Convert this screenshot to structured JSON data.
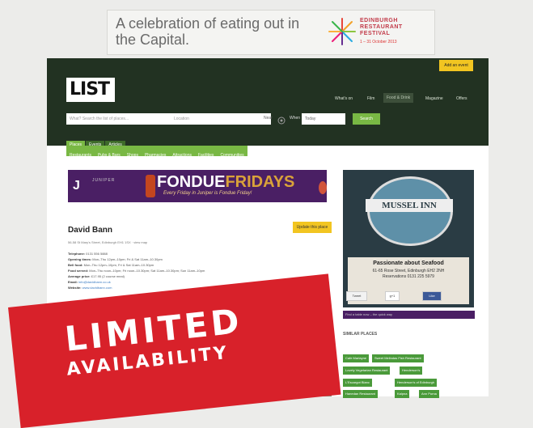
{
  "ad_banner": {
    "text": "A celebration of eating out in the Capital.",
    "festival_name": "EDINBURGH RESTAURANT FESTIVAL",
    "festival_dates": "1 – 31 October 2013"
  },
  "header": {
    "add_event_label": "Add an event",
    "logo": "LIST",
    "nav": [
      "What's on",
      "Film",
      "Food & Drink",
      "Magazine",
      "Offers"
    ]
  },
  "search": {
    "what_placeholder": "What? Search the list of places...",
    "where_placeholder": "Location",
    "near_label": "Near",
    "when_label": "When",
    "when_value": "Today",
    "button_label": "Search"
  },
  "tabs_primary": [
    "Places",
    "Events",
    "Articles"
  ],
  "tabs_secondary": [
    "Restaurants",
    "Pubs & Bars",
    "Shops",
    "Pharmacies",
    "Attractions",
    "Facilities",
    "Communities"
  ],
  "fondue_ad": {
    "brand": "JUNIPER",
    "title_a": "FONDUE",
    "title_b": "FRIDAYS",
    "subtitle": "Every Friday in Juniper is Fondue Friday!"
  },
  "venue": {
    "title": "David Bann",
    "update_label": "Update this place",
    "address": "56-58 St Mary's Street, Edinburgh EH1 1SX · view map",
    "details": [
      {
        "label": "Telephone:",
        "value": "0131 556 5888"
      },
      {
        "label": "Opening times:",
        "value": "Mon–Thu 12pm–10pm; Fri & Sat 11am–10.30pm"
      },
      {
        "label": "Bell food:",
        "value": "Mon–Thu 12pm–10pm, Fri & Sat 11am–10.30pm"
      },
      {
        "label": "Food served:",
        "value": "Mon–Thu noon–10pm; Fri noon–10.30pm; Sat 11am–10.30pm; Sun 11am–10pm"
      },
      {
        "label": "Average price:",
        "value": "£17.95 (2 course meal)"
      },
      {
        "label": "Email:",
        "value": "info@davidbann.co.uk"
      },
      {
        "label": "Website:",
        "value": "www.davidbann.com"
      }
    ]
  },
  "mussel_ad": {
    "name": "MUSSEL INN",
    "slogan": "Passionate about Seafood",
    "address_line": "61-65 Rose Street, Edinburgh EH2 2NH",
    "reservations": "Reservations 0131 225 5979"
  },
  "social": {
    "tweet": "Tweet",
    "gplus": "g+1",
    "like": "Like"
  },
  "promo_bar": "Find a table now – the quick way",
  "similar": {
    "title": "SIMILAR PLACES",
    "chips": [
      "Cafe Marlayne",
      "Sweet Melindas Fish Restaurant",
      "Lovely Vegetarian Restaurant",
      "Henderson's",
      "L'Escargot Blanc",
      "Henderson's of Edinburgh",
      "Hanedan Restaurant",
      "Kalpna",
      "Ann Purna",
      "Dakhin",
      "Mosque Kitchen"
    ]
  },
  "overlay": {
    "line1": "LIMITED",
    "line2": "AVAILABILITY"
  },
  "colors": {
    "header_bg": "#223222",
    "accent_green": "#79b844",
    "accent_yellow": "#f2c521",
    "overlay_red": "#d8212a",
    "ad_purple": "#4a1f64"
  }
}
